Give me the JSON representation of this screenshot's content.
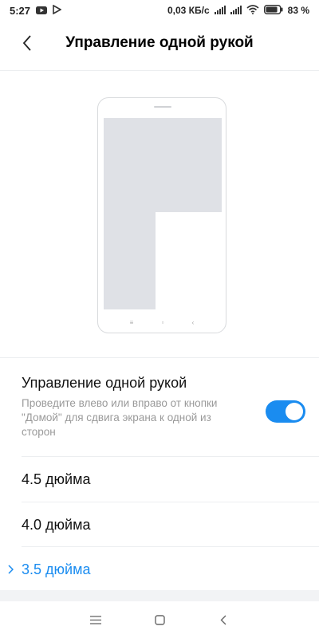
{
  "status_bar": {
    "time": "5:27",
    "speed": "0,03 КБ/с",
    "battery_percent": "83 %",
    "icons": [
      "youtube-icon",
      "play-store-icon",
      "signal-icon",
      "signal-icon",
      "wifi-icon",
      "battery-icon"
    ],
    "battery_level": 0.83
  },
  "header": {
    "title": "Управление одной рукой"
  },
  "setting": {
    "title": "Управление одной рукой",
    "description": "Проведите влево или вправо от кнопки \"Домой\" для сдвига экрана к одной из сторон",
    "enabled": true
  },
  "options": [
    {
      "label": "4.5 дюйма",
      "selected": false
    },
    {
      "label": "4.0 дюйма",
      "selected": false
    },
    {
      "label": "3.5 дюйма",
      "selected": true
    }
  ],
  "colors": {
    "accent": "#1a8cf0",
    "secondary_text": "#9a9a9a",
    "divider": "#eceef0"
  }
}
